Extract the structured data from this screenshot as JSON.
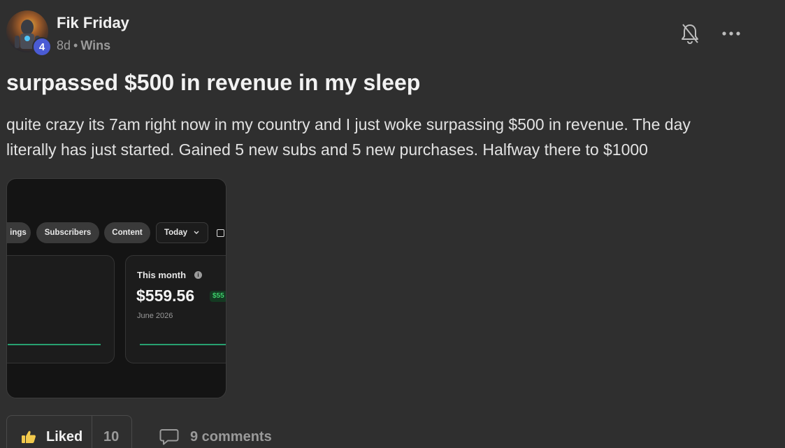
{
  "author": {
    "name": "Fik Friday",
    "level": "4",
    "time_ago": "8d",
    "separator": "•",
    "category": "Wins"
  },
  "icons": {
    "notify": "bell-off-icon",
    "menu": "more-horizontal-icon",
    "like": "thumbs-up-icon",
    "comment": "comment-icon"
  },
  "post": {
    "title": "surpassed $500 in revenue in my sleep",
    "body": "quite crazy its 7am right now in my country and I just woke surpassing $500 in revenue. The day literally has just started. Gained 5 new subs and 5 new purchases. Halfway there to $1000"
  },
  "attachment": {
    "tabs": [
      "ings",
      "Subscribers",
      "Content"
    ],
    "range": "Today",
    "card_label": "This month",
    "card_amount": "$559.56",
    "card_delta": "$55",
    "card_period": "June 2026"
  },
  "actions": {
    "like_label": "Liked",
    "like_count": "10",
    "comments_label": "9 comments"
  },
  "colors": {
    "background": "#2f2f2f",
    "level_badge": "#4a5bd4",
    "positive": "#3dd16b",
    "spark_line": "#27a070"
  }
}
